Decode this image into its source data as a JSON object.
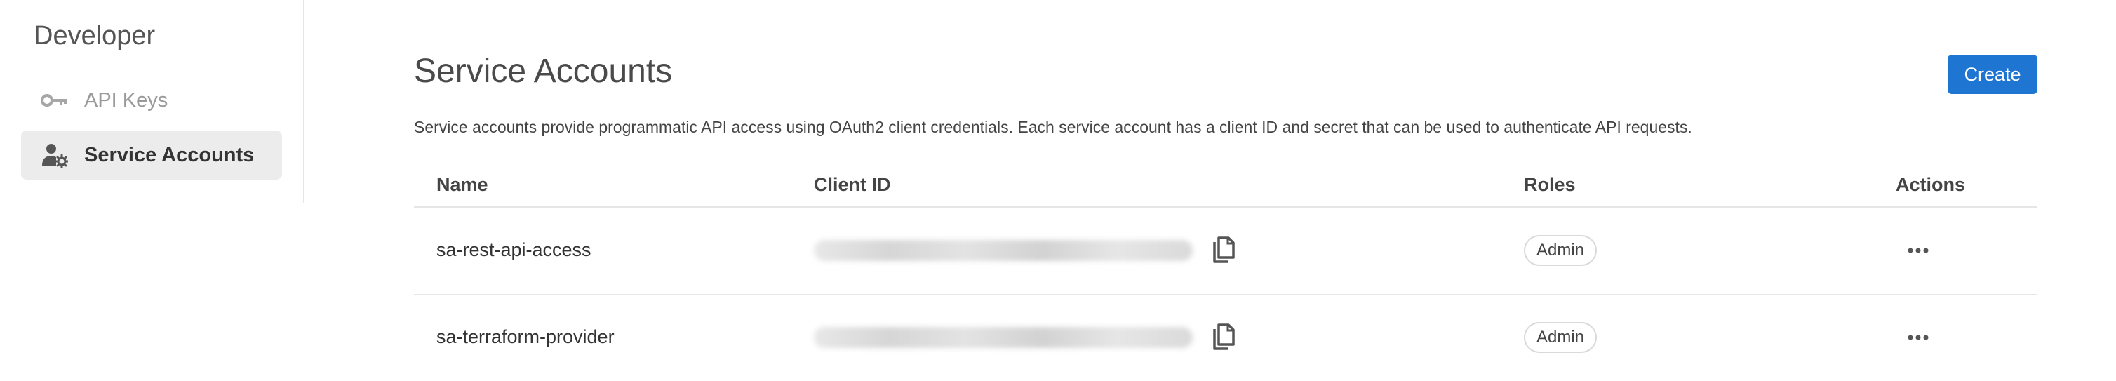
{
  "sidebar": {
    "title": "Developer",
    "items": [
      {
        "label": "API Keys",
        "icon": "key-icon",
        "active": false
      },
      {
        "label": "Service Accounts",
        "icon": "user-gear-icon",
        "active": true
      }
    ]
  },
  "main": {
    "title": "Service Accounts",
    "create_label": "Create",
    "description": "Service accounts provide programmatic API access using OAuth2 client credentials. Each service account has a client ID and secret that can be used to authenticate API requests."
  },
  "table": {
    "columns": [
      "Name",
      "Client ID",
      "Roles",
      "Actions"
    ],
    "rows": [
      {
        "name": "sa-rest-api-access",
        "client_id": "",
        "role": "Admin"
      },
      {
        "name": "sa-terraform-provider",
        "client_id": "",
        "role": "Admin"
      }
    ]
  },
  "colors": {
    "accent": "#1f76d2",
    "sidebar_active_bg": "#ececec",
    "muted_text": "#999999",
    "divider": "#e6e6e6"
  },
  "icons": {
    "copy": "copy-icon",
    "more": "more-horizontal-icon"
  }
}
